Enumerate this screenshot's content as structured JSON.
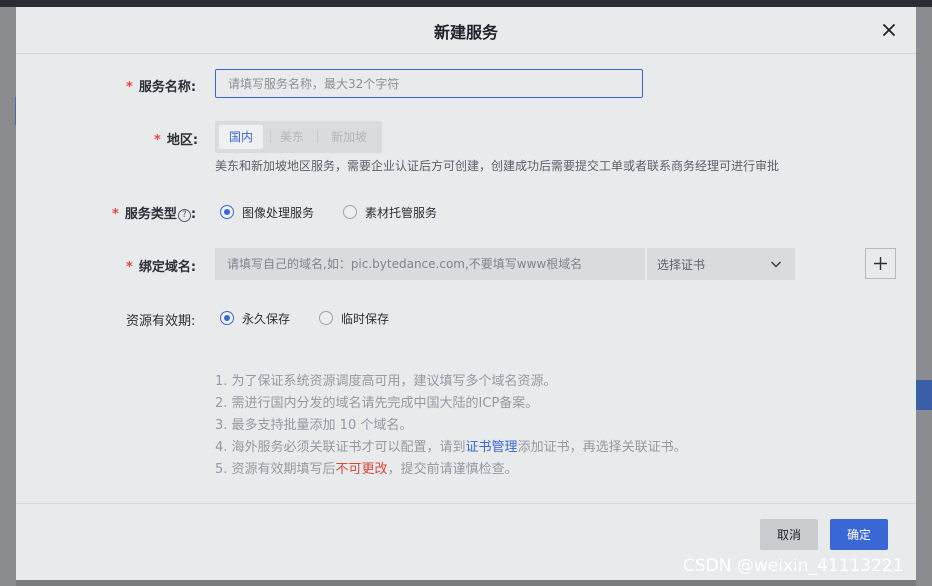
{
  "dialog": {
    "title": "新建服务",
    "close_icon": "close-icon"
  },
  "form": {
    "service_name": {
      "label": "服务名称:",
      "placeholder": "请填写服务名称，最大32个字符"
    },
    "region": {
      "label": "地区:",
      "options": [
        "国内",
        "美东",
        "新加坡"
      ],
      "selected": "国内",
      "hint": "美东和新加坡地区服务，需要企业认证后方可创建，创建成功后需要提交工单或者联系商务经理可进行审批"
    },
    "service_type": {
      "label": "服务类型",
      "help_icon": "?",
      "options": [
        "图像处理服务",
        "素材托管服务"
      ],
      "selected": "图像处理服务"
    },
    "domain": {
      "label": "绑定域名:",
      "placeholder": "请填写自己的域名,如：pic.bytedance.com,不要填写www根域名",
      "cert_select": "选择证书"
    },
    "validity": {
      "label": "资源有效期:",
      "options": [
        "永久保存",
        "临时保存"
      ],
      "selected": "永久保存"
    }
  },
  "notes": {
    "line1": "1. 为了保证系统资源调度高可用，建议填写多个域名资源。",
    "line2": "2. 需进行国内分发的域名请先完成中国大陆的ICP备案。",
    "line3": "3. 最多支持批量添加 10 个域名。",
    "line4_pre": "4. 海外服务必须关联证书才可以配置，请到",
    "line4_link": "证书管理",
    "line4_post": "添加证书，再选择关联证书。",
    "line5_pre": "5. 资源有效期填写后",
    "line5_warn": "不可更改",
    "line5_post": "，提交前请谨慎检查。"
  },
  "footer": {
    "cancel": "取消",
    "confirm": "确定"
  },
  "watermark": "CSDN @weixin_41113221",
  "colors": {
    "primary": "#3a67d6",
    "required": "#e5483d",
    "warning": "#d8463c"
  }
}
